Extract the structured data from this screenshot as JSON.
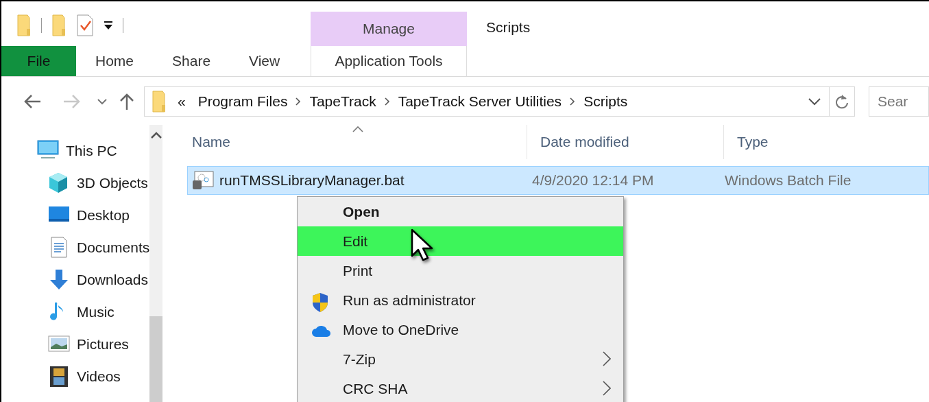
{
  "quick_access": [
    {
      "kind": "folder"
    },
    {
      "kind": "separator"
    },
    {
      "kind": "folder"
    },
    {
      "kind": "properties"
    },
    {
      "kind": "customize"
    },
    {
      "kind": "separator"
    }
  ],
  "context_tab": {
    "group": "Manage",
    "label": "Application Tools",
    "selected": false
  },
  "window": {
    "title": "Scripts"
  },
  "ribbon_tabs": [
    {
      "label": "File",
      "kind": "file"
    },
    {
      "label": "Home",
      "kind": "tab"
    },
    {
      "label": "Share",
      "kind": "tab"
    },
    {
      "label": "View",
      "kind": "tab"
    }
  ],
  "address": {
    "overflow": "«",
    "segments": [
      "Program Files",
      "TapeTrack",
      "TapeTrack Server Utilities",
      "Scripts"
    ]
  },
  "search": {
    "placeholder": "Sear"
  },
  "nav_pane": [
    {
      "label": "This PC",
      "kind": "pc",
      "children": [
        {
          "label": "3D Objects",
          "kind": "cube"
        },
        {
          "label": "Desktop",
          "kind": "desktop"
        },
        {
          "label": "Documents",
          "kind": "document"
        },
        {
          "label": "Downloads",
          "kind": "download"
        },
        {
          "label": "Music",
          "kind": "music"
        },
        {
          "label": "Pictures",
          "kind": "picture"
        },
        {
          "label": "Videos",
          "kind": "video"
        }
      ]
    }
  ],
  "columns": [
    {
      "label": "Name",
      "sorted": true
    },
    {
      "label": "Date modified",
      "sorted": false
    },
    {
      "label": "Type",
      "sorted": false
    }
  ],
  "files": [
    {
      "name": "runTMSSLibraryManager.bat",
      "date": "4/9/2020 12:14 PM",
      "type": "Windows Batch File",
      "selected": true
    }
  ],
  "context_menu": [
    {
      "label": "Open",
      "kind": "default",
      "selected": false
    },
    {
      "label": "Edit",
      "kind": "plain",
      "selected": true
    },
    {
      "label": "Print",
      "kind": "plain",
      "selected": false
    },
    {
      "label": "Run as administrator",
      "kind": "shield",
      "selected": false
    },
    {
      "label": "Move to OneDrive",
      "kind": "cloud",
      "selected": false
    },
    {
      "label": "7-Zip",
      "kind": "submenu",
      "selected": false
    },
    {
      "label": "CRC SHA",
      "kind": "submenu",
      "selected": false
    }
  ]
}
